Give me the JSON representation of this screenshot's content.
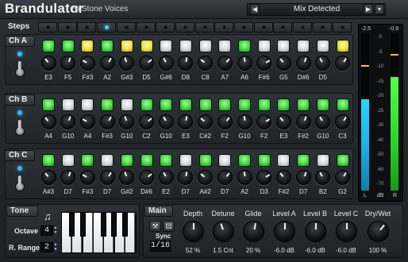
{
  "header": {
    "title": "Brandulator",
    "brand": "Stone Voices",
    "brand_icon": "copyright-icon",
    "preset_prev": "◀",
    "preset_name": "Mix Detected",
    "preset_next": "▶",
    "menu_icon": "▾"
  },
  "steps": {
    "label": "Steps",
    "count": 16,
    "active_index": 3
  },
  "channels": [
    {
      "label": "Ch A",
      "pads": [
        "green",
        "green",
        "yellow",
        "green",
        "yellow",
        "yellow",
        "white",
        "white",
        "white",
        "white",
        "green",
        "white",
        "white",
        "white",
        "white",
        "yellow"
      ],
      "notes": [
        "E3",
        "F5",
        "F#3",
        "A2",
        "G#3",
        "D5",
        "G#6",
        "D8",
        "C8",
        "A7",
        "A6",
        "F#6",
        "G5",
        "D#6",
        "D5",
        ""
      ]
    },
    {
      "label": "Ch B",
      "pads": [
        "green",
        "white",
        "white",
        "green",
        "white",
        "green",
        "green",
        "green",
        "green",
        "green",
        "green",
        "green",
        "green",
        "green",
        "green",
        "green"
      ],
      "notes": [
        "A4",
        "G10",
        "A4",
        "F#3",
        "G10",
        "C2",
        "G10",
        "E3",
        "C#2",
        "F2",
        "G10",
        "F2",
        "E3",
        "F#2",
        "G10",
        "C3"
      ]
    },
    {
      "label": "Ch C",
      "pads": [
        "green",
        "white",
        "green",
        "white",
        "green",
        "green",
        "green",
        "white",
        "green",
        "white",
        "green",
        "green",
        "white",
        "green",
        "white",
        "green"
      ],
      "notes": [
        "A#3",
        "D7",
        "F#3",
        "D7",
        "G#2",
        "D#6",
        "E2",
        "D7",
        "A#2",
        "D7",
        "A2",
        "D3",
        "F#2",
        "D7",
        "B2",
        "G2"
      ]
    }
  ],
  "meter": {
    "left_label": "-2.5",
    "right_label": "-0.9",
    "left_level": 0.58,
    "right_level": 0.72,
    "left_peak": 0.79,
    "right_peak": 0.86,
    "scale": [
      "0",
      "-5",
      "-10",
      "-15",
      "-20",
      "-25",
      "-30",
      "-40",
      "-50",
      "-60",
      "-70"
    ],
    "bottom": [
      "L",
      "dB",
      "R"
    ]
  },
  "tone": {
    "label": "Tone",
    "octave_label": "Octave",
    "octave_value": "4",
    "range_label": "R. Range",
    "range_value": "2",
    "note_icon": "music-note-icon"
  },
  "main": {
    "label": "Main",
    "sync_label": "Sync",
    "sync_value": "1/16",
    "knobs": [
      {
        "name": "Depth",
        "value": "52 %"
      },
      {
        "name": "Detune",
        "value": "1.5 Cnt"
      },
      {
        "name": "Glide",
        "value": "20 %"
      },
      {
        "name": "Level A",
        "value": "-6.0 dB"
      },
      {
        "name": "Level B",
        "value": "-6.0 dB"
      },
      {
        "name": "Level C",
        "value": "-6.0 dB"
      },
      {
        "name": "Dry/Wet",
        "value": "100 %"
      }
    ]
  },
  "colors": {
    "accent": "#39d4ff",
    "pad_green": "#3bd33b",
    "pad_yellow": "#e8dc3a",
    "pad_white": "#cfd4d8"
  }
}
